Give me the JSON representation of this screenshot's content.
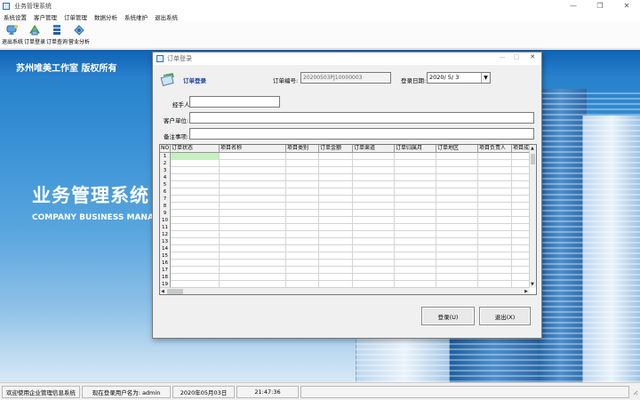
{
  "window": {
    "title": "业务管理系统"
  },
  "menu": [
    "系统设置",
    "客户管理",
    "订单管理",
    "数据分析",
    "系统维护",
    "退出系统"
  ],
  "toolbar": [
    {
      "label": "退出系统",
      "icon": "exit-icon"
    },
    {
      "label": "订单登录",
      "icon": "order-entry-icon"
    },
    {
      "label": "订单查询",
      "icon": "order-query-icon"
    },
    {
      "label": "营业分析",
      "icon": "analysis-icon"
    }
  ],
  "splash": {
    "company": "苏州唯美工作室 版权所有",
    "system_name": "业务管理系统",
    "system_name_en": "COMPANY BUSINESS MANAGE"
  },
  "dialog": {
    "title": "订单登录",
    "heading": "订单登录",
    "order_no_label": "订单编号:",
    "order_no_value": "20200503PJ10000003",
    "date_label": "登录日期:",
    "date_value": "2020/ 5/ 3",
    "handler_label": "经手人:",
    "handler_value": "",
    "customer_label": "客户单位:",
    "customer_value": "",
    "remarks_label": "备注事项:",
    "remarks_value": "",
    "grid": {
      "corner": "NO",
      "columns": [
        "订单状态",
        "项目名称",
        "项目类别",
        "订单金额",
        "订单渠道",
        "订单归属月",
        "订单地区",
        "项目负责人",
        "项目成"
      ],
      "rows": [
        "1",
        "2",
        "3",
        "4",
        "5",
        "6",
        "7",
        "8",
        "9",
        "10",
        "11",
        "12",
        "13",
        "14",
        "15",
        "16",
        "17",
        "18",
        "19"
      ]
    },
    "login_button": "登录(U)",
    "exit_button": "退出(X)"
  },
  "status": {
    "welcome": "欢迎使用企业管理信息系统",
    "user": "现在登录用户名为: admin",
    "date": "2020年05月03日",
    "time": "21:47:36"
  },
  "colors": {
    "accent": "#1f7bc8",
    "selected_cell": "#c6efc0",
    "heading": "#1a3fa8"
  }
}
